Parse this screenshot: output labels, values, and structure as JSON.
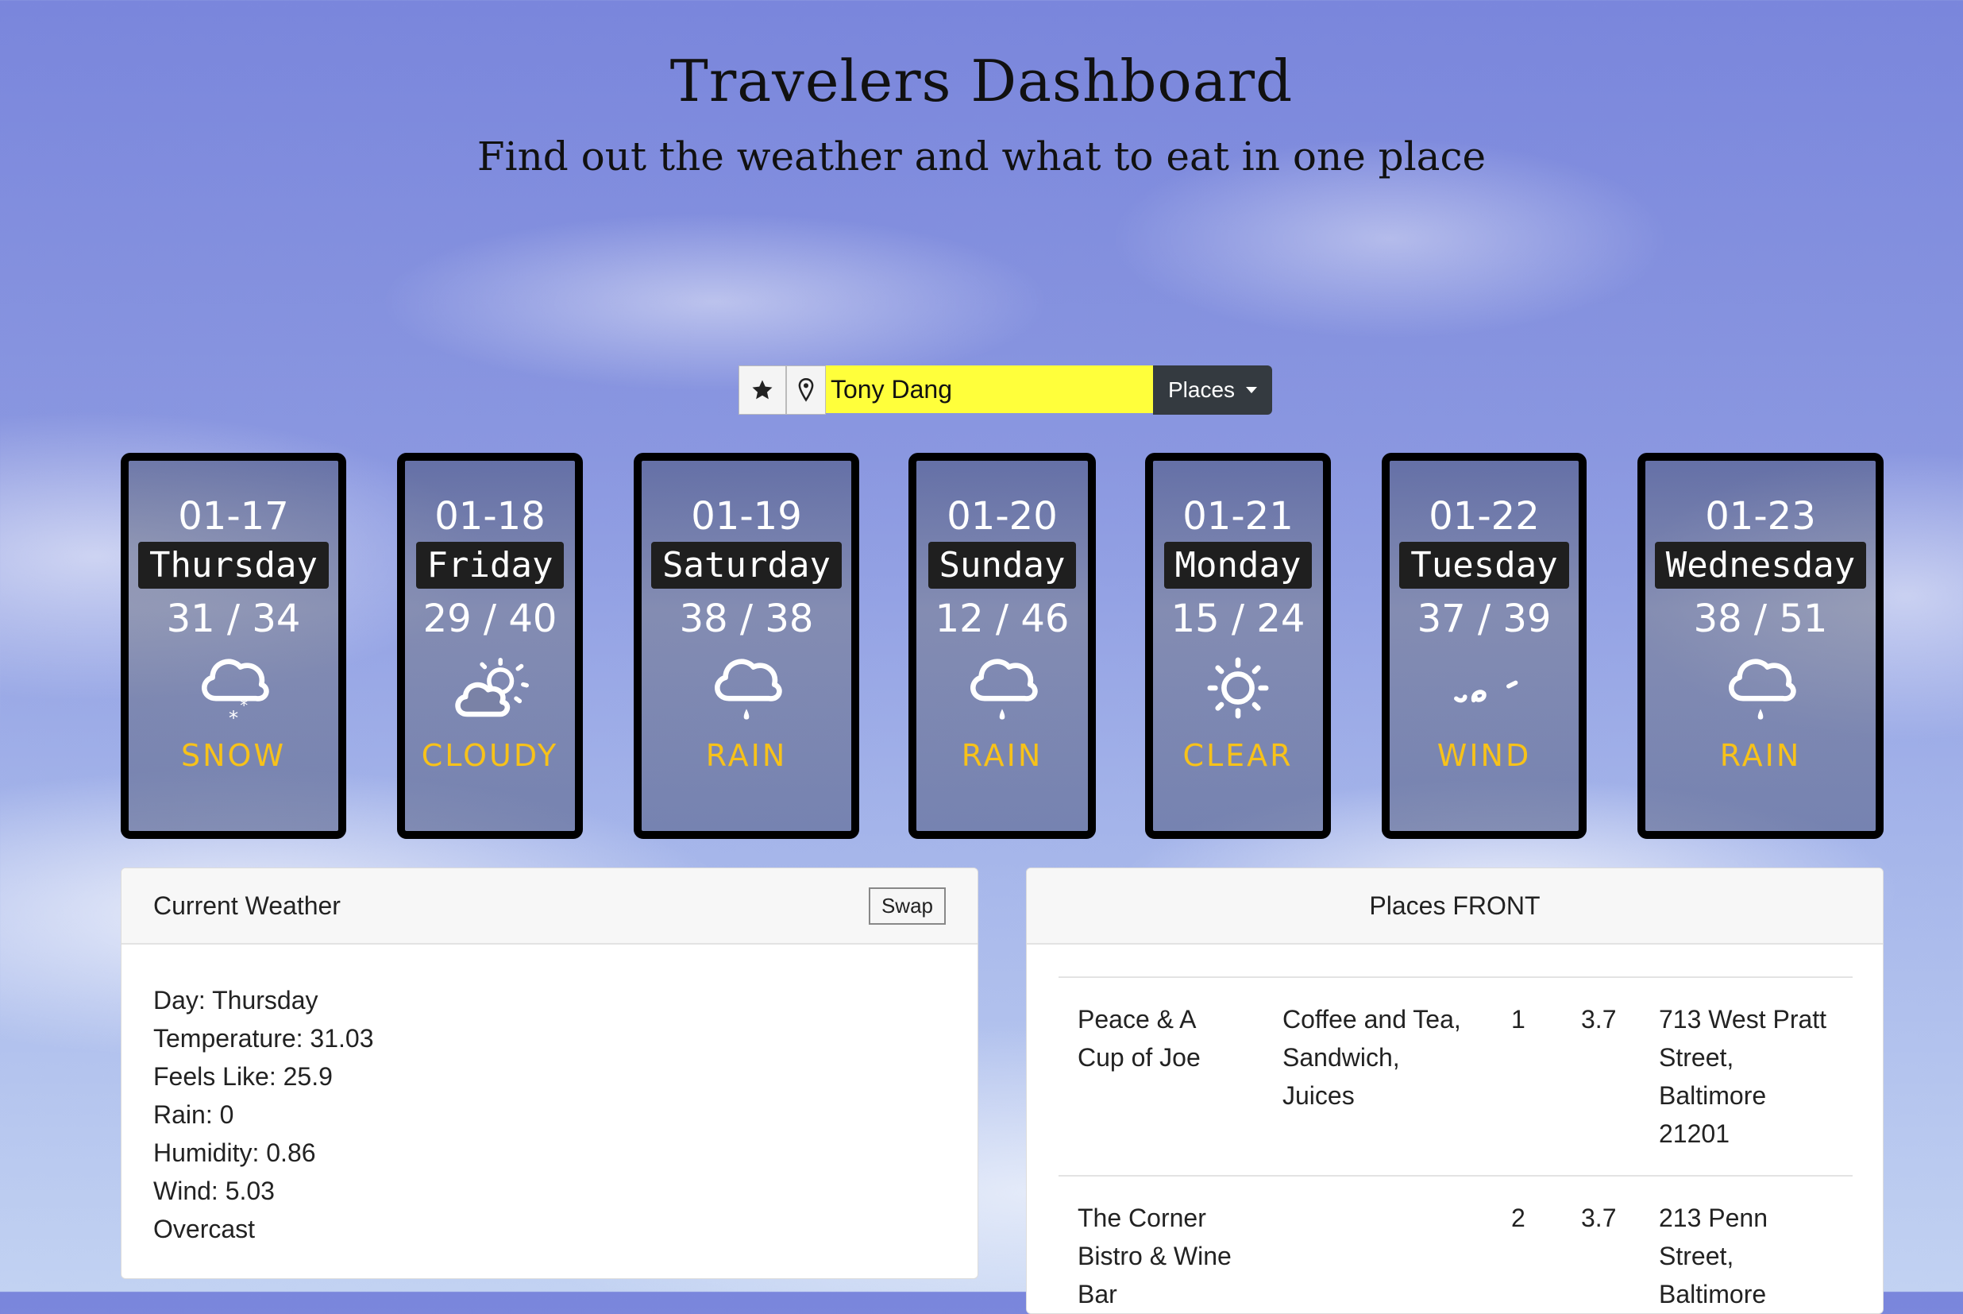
{
  "header": {
    "title": "Travelers Dashboard",
    "subtitle": "Find out the weather and what to eat in one place"
  },
  "search": {
    "star_icon": "star-icon",
    "location_icon": "map-pin-icon",
    "value": "Tony Dang",
    "dropdown_label": "Places"
  },
  "forecast": [
    {
      "date": "01-17",
      "day": "Thursday",
      "temp": "31 / 34",
      "condition": "SNOW",
      "icon": "snow-icon"
    },
    {
      "date": "01-18",
      "day": "Friday",
      "temp": "29 / 40",
      "condition": "CLOUDY",
      "icon": "partly-cloudy-icon"
    },
    {
      "date": "01-19",
      "day": "Saturday",
      "temp": "38 / 38",
      "condition": "RAIN",
      "icon": "rain-icon"
    },
    {
      "date": "01-20",
      "day": "Sunday",
      "temp": "12 / 46",
      "condition": "RAIN",
      "icon": "rain-icon"
    },
    {
      "date": "01-21",
      "day": "Monday",
      "temp": "15 / 24",
      "condition": "CLEAR",
      "icon": "sun-icon"
    },
    {
      "date": "01-22",
      "day": "Tuesday",
      "temp": "37 / 39",
      "condition": "WIND",
      "icon": "wind-icon"
    },
    {
      "date": "01-23",
      "day": "Wednesday",
      "temp": "38 / 51",
      "condition": "RAIN",
      "icon": "rain-icon"
    }
  ],
  "current": {
    "title": "Current Weather",
    "swap_label": "Swap",
    "lines": [
      "Day: Thursday",
      "Temperature: 31.03",
      "Feels Like: 25.9",
      "Rain: 0",
      "Humidity: 0.86",
      "Wind: 5.03",
      "Overcast"
    ]
  },
  "places": {
    "title": "Places FRONT",
    "rows": [
      {
        "name": "Peace & A Cup of Joe",
        "category": "Coffee and Tea, Sandwich, Juices",
        "price": "1",
        "rating": "3.7",
        "address": "713 West Pratt Street, Baltimore 21201"
      },
      {
        "name": "The Corner Bistro & Wine Bar",
        "category": "",
        "price": "2",
        "rating": "3.7",
        "address": "213 Penn Street, Baltimore"
      }
    ]
  },
  "colors": {
    "accent_yellow": "#ffff3b",
    "condition_text": "#f7c21a",
    "dark_button": "#343a40"
  }
}
